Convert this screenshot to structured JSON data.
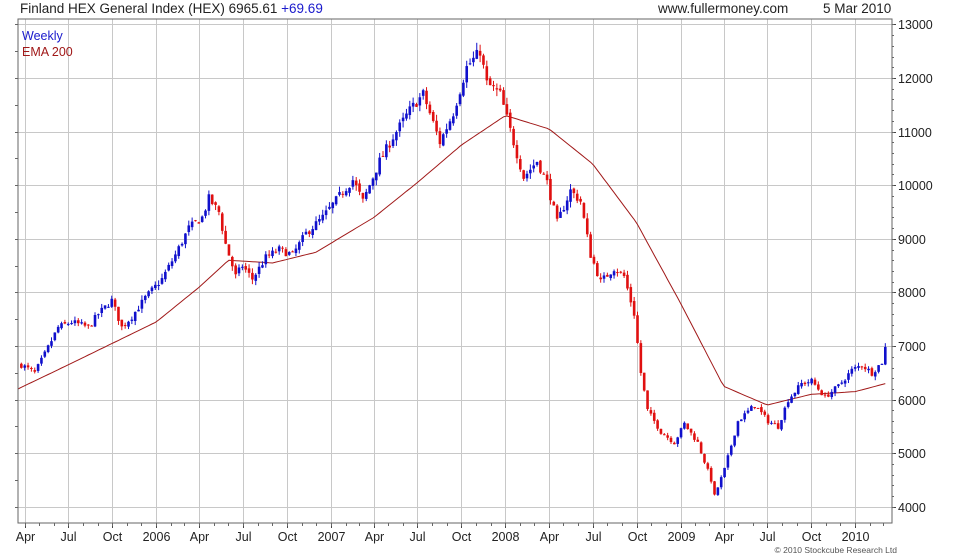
{
  "header": {
    "title": "Finland HEX General Index (HEX) 6965.61",
    "change": "+69.69",
    "site": "www.fullermoney.com",
    "date": "5 Mar 2010"
  },
  "footer": {
    "copyright": "© 2010 Stockcube Research Ltd"
  },
  "colors": {
    "up": "#1010cc",
    "down": "#e01010",
    "ema": "#a01818",
    "grid": "#c8c8c8",
    "frame": "#666666"
  },
  "chart_data": {
    "type": "candlestick",
    "legend": [
      {
        "label": "Weekly",
        "color": "#1a1acc"
      },
      {
        "label": "EMA 200",
        "color": "#a01818"
      }
    ],
    "ylim": [
      3700,
      13100
    ],
    "y_ticks": [
      4000,
      5000,
      6000,
      7000,
      8000,
      9000,
      10000,
      11000,
      12000,
      13000
    ],
    "y_tick_labels": [
      "4000",
      "5000",
      "6000",
      "7000",
      "8000",
      "9000",
      "10000",
      "11000",
      "12000",
      "13000"
    ],
    "x_range": [
      "2005-03-18",
      "2010-03-19"
    ],
    "x_ticks": [
      {
        "date": "2005-04-01",
        "label": "Apr"
      },
      {
        "date": "2005-07-01",
        "label": "Jul"
      },
      {
        "date": "2005-10-01",
        "label": "Oct"
      },
      {
        "date": "2006-01-01",
        "label": "2006"
      },
      {
        "date": "2006-04-01",
        "label": "Apr"
      },
      {
        "date": "2006-07-01",
        "label": "Jul"
      },
      {
        "date": "2006-10-01",
        "label": "Oct"
      },
      {
        "date": "2007-01-01",
        "label": "2007"
      },
      {
        "date": "2007-04-01",
        "label": "Apr"
      },
      {
        "date": "2007-07-01",
        "label": "Jul"
      },
      {
        "date": "2007-10-01",
        "label": "Oct"
      },
      {
        "date": "2008-01-01",
        "label": "2008"
      },
      {
        "date": "2008-04-01",
        "label": "Apr"
      },
      {
        "date": "2008-07-01",
        "label": "Jul"
      },
      {
        "date": "2008-10-01",
        "label": "Oct"
      },
      {
        "date": "2009-01-01",
        "label": "2009"
      },
      {
        "date": "2009-04-01",
        "label": "Apr"
      },
      {
        "date": "2009-07-01",
        "label": "Jul"
      },
      {
        "date": "2009-10-01",
        "label": "Oct"
      },
      {
        "date": "2010-01-01",
        "label": "2010"
      }
    ],
    "weekly_close_anchors": [
      [
        "2005-03-25",
        6650
      ],
      [
        "2005-04-22",
        6500
      ],
      [
        "2005-05-13",
        6850
      ],
      [
        "2005-06-10",
        7350
      ],
      [
        "2005-07-08",
        7450
      ],
      [
        "2005-08-12",
        7350
      ],
      [
        "2005-09-02",
        7600
      ],
      [
        "2005-09-30",
        7850
      ],
      [
        "2005-10-21",
        7350
      ],
      [
        "2005-11-11",
        7550
      ],
      [
        "2005-12-09",
        7900
      ],
      [
        "2006-01-13",
        8250
      ],
      [
        "2006-02-10",
        8700
      ],
      [
        "2006-03-10",
        9200
      ],
      [
        "2006-04-07",
        9400
      ],
      [
        "2006-04-21",
        9750
      ],
      [
        "2006-05-12",
        9500
      ],
      [
        "2006-05-26",
        8900
      ],
      [
        "2006-06-16",
        8300
      ],
      [
        "2006-06-30",
        8500
      ],
      [
        "2006-07-21",
        8250
      ],
      [
        "2006-08-18",
        8650
      ],
      [
        "2006-09-15",
        8800
      ],
      [
        "2006-10-13",
        8700
      ],
      [
        "2006-11-10",
        9100
      ],
      [
        "2006-12-15",
        9400
      ],
      [
        "2007-01-19",
        9800
      ],
      [
        "2007-02-16",
        10100
      ],
      [
        "2007-03-09",
        9700
      ],
      [
        "2007-04-13",
        10450
      ],
      [
        "2007-05-11",
        10900
      ],
      [
        "2007-06-15",
        11400
      ],
      [
        "2007-07-13",
        11700
      ],
      [
        "2007-08-17",
        10800
      ],
      [
        "2007-09-14",
        11350
      ],
      [
        "2007-10-12",
        12200
      ],
      [
        "2007-11-09",
        12500
      ],
      [
        "2007-11-23",
        11900
      ],
      [
        "2007-12-21",
        11700
      ],
      [
        "2008-01-18",
        10800
      ],
      [
        "2008-02-08",
        10150
      ],
      [
        "2008-03-07",
        10450
      ],
      [
        "2008-03-28",
        10050
      ],
      [
        "2008-04-18",
        9300
      ],
      [
        "2008-05-16",
        9900
      ],
      [
        "2008-06-06",
        9700
      ],
      [
        "2008-06-27",
        8700
      ],
      [
        "2008-07-18",
        8200
      ],
      [
        "2008-08-15",
        8450
      ],
      [
        "2008-09-05",
        8300
      ],
      [
        "2008-09-26",
        7600
      ],
      [
        "2008-10-10",
        6500
      ],
      [
        "2008-10-24",
        5800
      ],
      [
        "2008-11-21",
        5400
      ],
      [
        "2008-12-19",
        5200
      ],
      [
        "2009-01-09",
        5550
      ],
      [
        "2009-02-06",
        5200
      ],
      [
        "2009-03-06",
        4500
      ],
      [
        "2009-03-13",
        4200
      ],
      [
        "2009-04-03",
        4700
      ],
      [
        "2009-05-01",
        5600
      ],
      [
        "2009-06-05",
        5900
      ],
      [
        "2009-07-03",
        5600
      ],
      [
        "2009-07-24",
        5500
      ],
      [
        "2009-08-14",
        6000
      ],
      [
        "2009-09-11",
        6300
      ],
      [
        "2009-10-02",
        6350
      ],
      [
        "2009-10-30",
        6050
      ],
      [
        "2009-11-27",
        6250
      ],
      [
        "2009-12-25",
        6550
      ],
      [
        "2010-01-15",
        6650
      ],
      [
        "2010-02-05",
        6500
      ],
      [
        "2010-02-26",
        6700
      ],
      [
        "2010-03-05",
        6966
      ]
    ],
    "ema_200_anchors": [
      [
        "2005-03-18",
        6200
      ],
      [
        "2005-07-01",
        6650
      ],
      [
        "2005-10-01",
        7050
      ],
      [
        "2006-01-01",
        7450
      ],
      [
        "2006-04-01",
        8100
      ],
      [
        "2006-06-01",
        8600
      ],
      [
        "2006-09-01",
        8550
      ],
      [
        "2006-12-01",
        8750
      ],
      [
        "2007-04-01",
        9400
      ],
      [
        "2007-07-01",
        10050
      ],
      [
        "2007-10-01",
        10750
      ],
      [
        "2008-01-01",
        11300
      ],
      [
        "2008-04-01",
        11050
      ],
      [
        "2008-07-01",
        10400
      ],
      [
        "2008-10-01",
        9300
      ],
      [
        "2009-01-01",
        7800
      ],
      [
        "2009-04-01",
        6250
      ],
      [
        "2009-07-01",
        5900
      ],
      [
        "2009-10-01",
        6100
      ],
      [
        "2010-01-01",
        6150
      ],
      [
        "2010-03-05",
        6300
      ]
    ]
  }
}
